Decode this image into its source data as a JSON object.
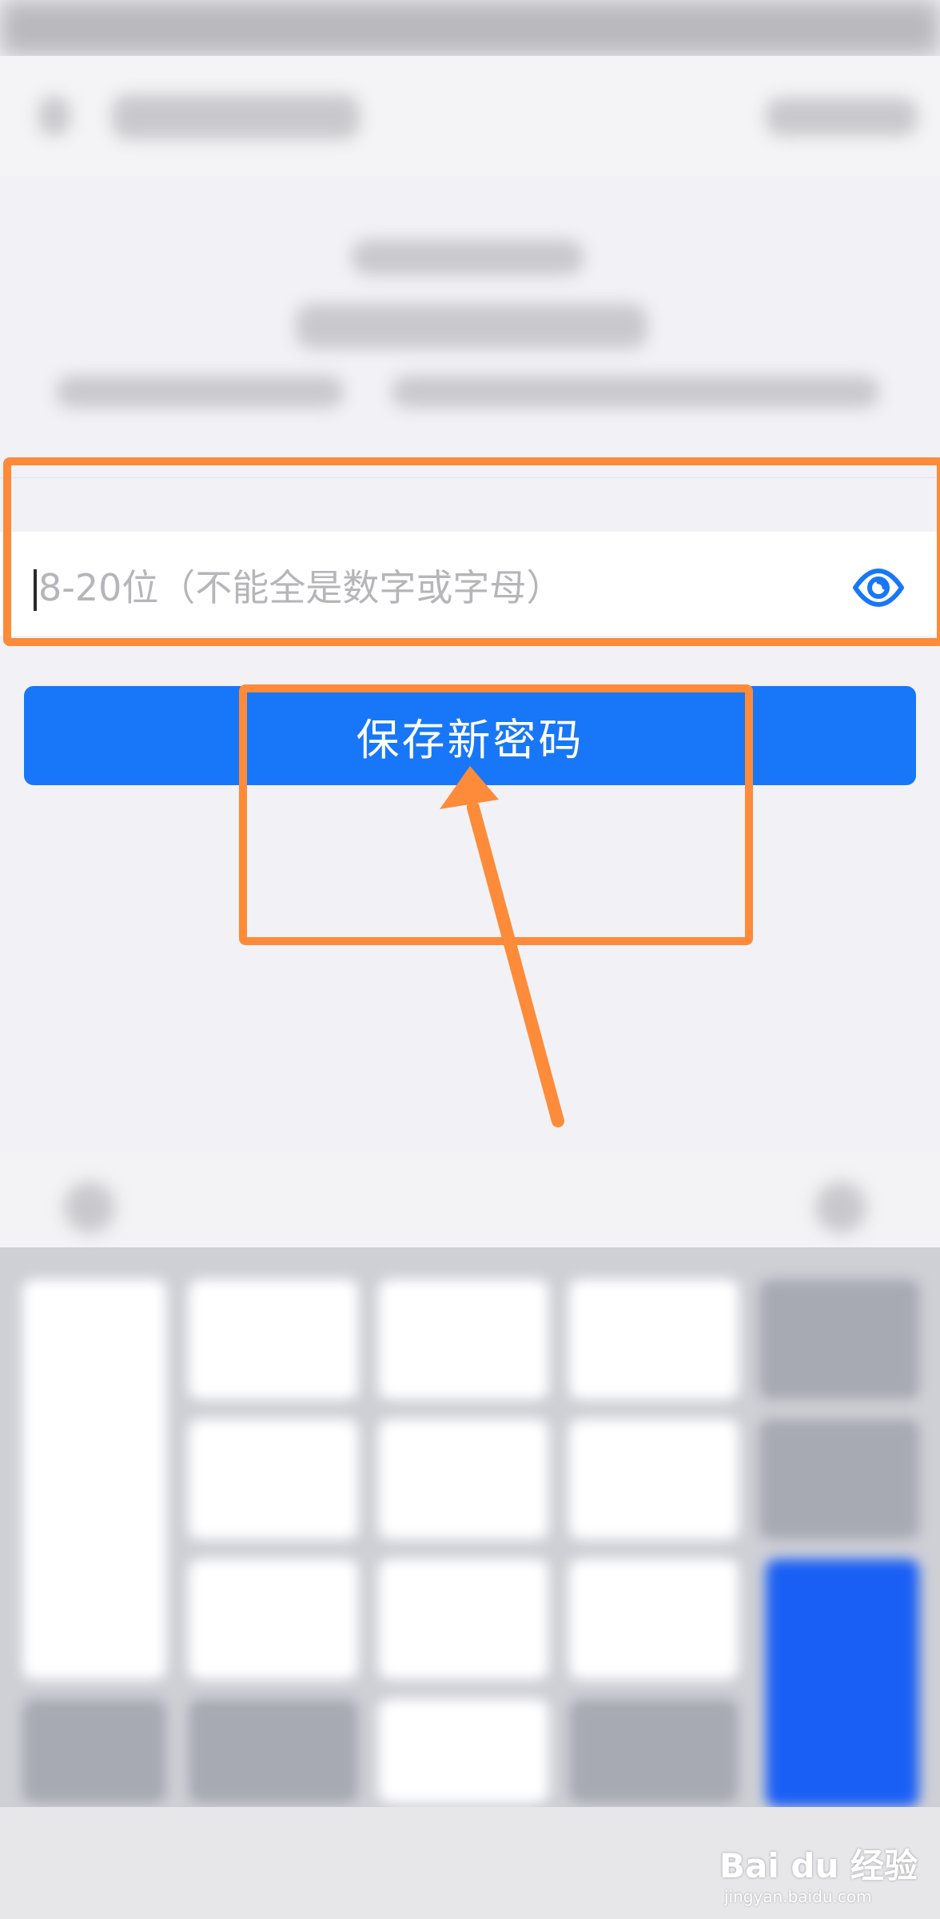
{
  "form": {
    "password_placeholder": "8-20位（不能全是数字或字母）",
    "save_label": "保存新密码"
  },
  "icons": {
    "eye": "eye-icon"
  },
  "colors": {
    "accent": "#1877f8",
    "annotation": "#fd8b39",
    "placeholder": "#b5b5ba"
  },
  "watermark": {
    "brand": "Bai du 经验",
    "url": "jingyan.baidu.com"
  }
}
